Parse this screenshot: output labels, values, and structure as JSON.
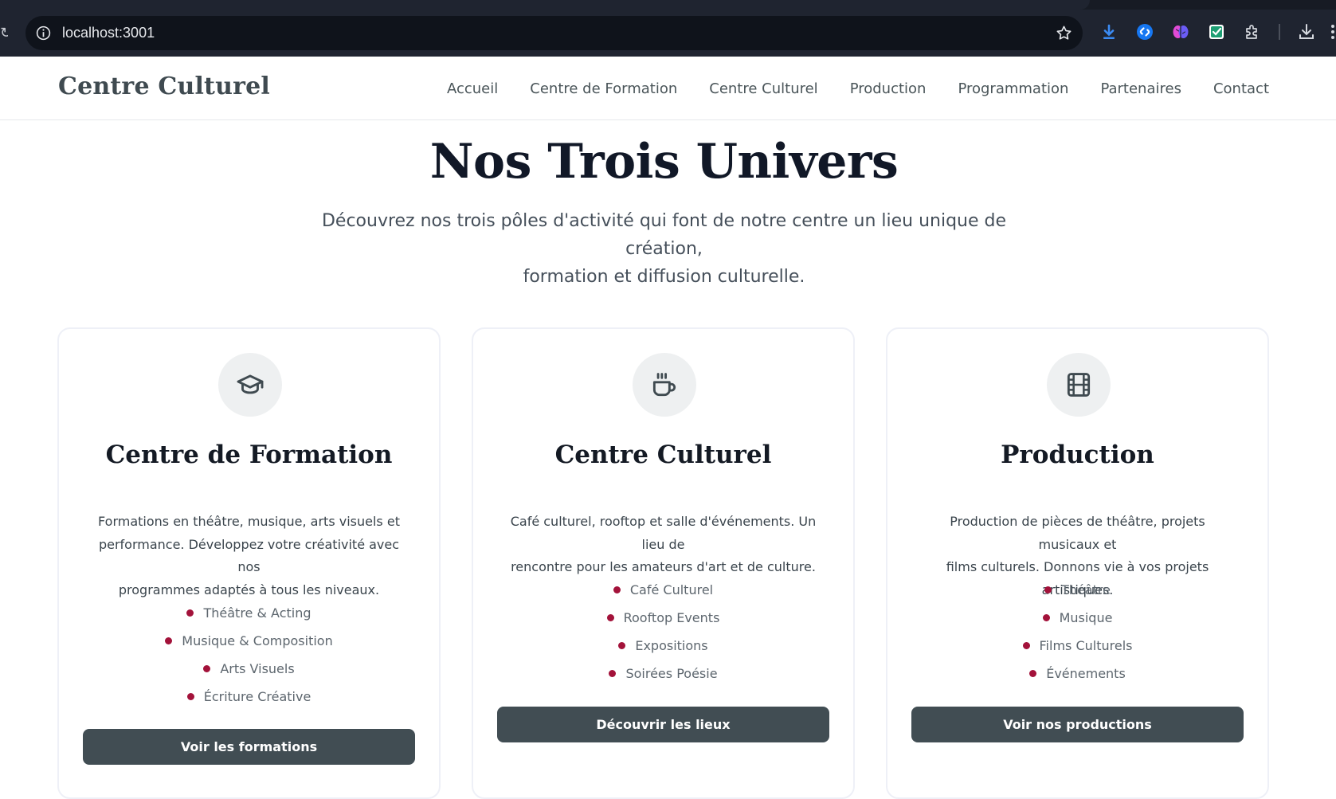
{
  "browser": {
    "url": "localhost:3001",
    "reload_glyph": "↻",
    "extensions": [
      "download-arrow-icon",
      "shazam-icon",
      "brain-icon",
      "checkbox-icon",
      "puzzle-icon"
    ],
    "icons": [
      "info-icon",
      "star-icon",
      "downloads-icon",
      "menu-icon"
    ],
    "colors": {
      "chrome": "#1f2430",
      "omnibox": "#0f131b"
    }
  },
  "header": {
    "logo": "Centre Culturel",
    "nav": [
      {
        "label": "Accueil"
      },
      {
        "label": "Centre de Formation"
      },
      {
        "label": "Centre Culturel"
      },
      {
        "label": "Production"
      },
      {
        "label": "Programmation"
      },
      {
        "label": "Partenaires"
      },
      {
        "label": "Contact"
      }
    ]
  },
  "hero": {
    "title": "Nos Trois Univers",
    "subtitle_line1": "Découvrez nos trois pôles d'activité qui font de notre centre un lieu unique de création,",
    "subtitle_line2": "formation et diffusion culturelle."
  },
  "cards": [
    {
      "icon": "graduation-cap-icon",
      "title": "Centre de Formation",
      "description_lines": [
        "Formations en théâtre, musique, arts visuels et",
        "performance. Développez votre créativité avec nos",
        "programmes adaptés à tous les niveaux."
      ],
      "items": [
        "Théâtre & Acting",
        "Musique & Composition",
        "Arts Visuels",
        "Écriture Créative"
      ],
      "button": "Voir les formations"
    },
    {
      "icon": "coffee-cup-icon",
      "title": "Centre Culturel",
      "description_lines": [
        "Café culturel, rooftop et salle d'événements. Un lieu de",
        "rencontre pour les amateurs d'art et de culture."
      ],
      "items": [
        "Café Culturel",
        "Rooftop Events",
        "Expositions",
        "Soirées Poésie"
      ],
      "button": "Découvrir les lieux"
    },
    {
      "icon": "film-icon",
      "title": "Production",
      "description_lines": [
        "Production de pièces de théâtre, projets musicaux et",
        "films culturels. Donnons vie à vos projets artistiques."
      ],
      "items": [
        "Théâtre",
        "Musique",
        "Films Culturels",
        "Événements"
      ],
      "button": "Voir nos productions"
    }
  ],
  "colors": {
    "accent_bullet": "#a3123a",
    "button_bg": "#414d53",
    "logo": "#3f4a50",
    "title": "#111827"
  }
}
